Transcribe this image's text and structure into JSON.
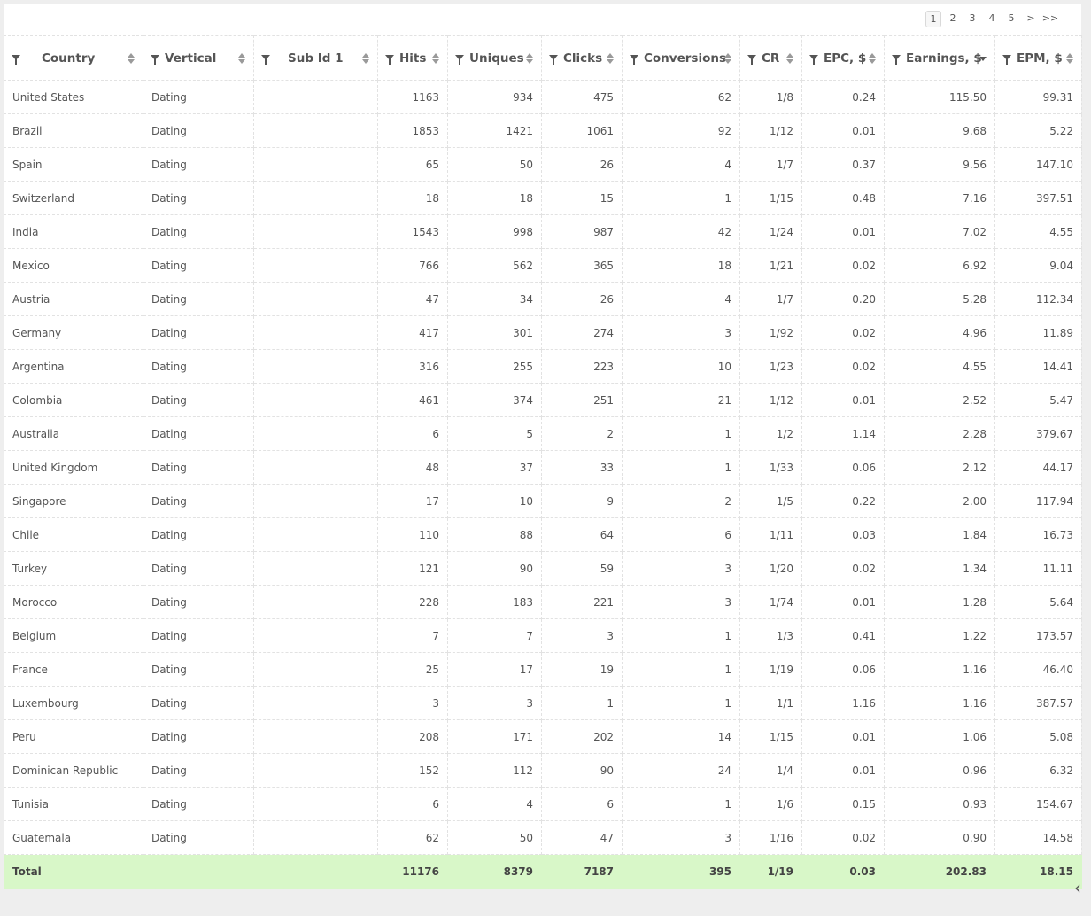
{
  "pagination": {
    "pages": [
      "1",
      "2",
      "3",
      "4",
      "5"
    ],
    "active": "1",
    "next_label": ">",
    "last_label": ">>"
  },
  "columns": [
    {
      "key": "country",
      "label": "Country"
    },
    {
      "key": "vertical",
      "label": "Vertical"
    },
    {
      "key": "subid",
      "label": "Sub Id 1"
    },
    {
      "key": "hits",
      "label": "Hits"
    },
    {
      "key": "uniques",
      "label": "Uniques"
    },
    {
      "key": "clicks",
      "label": "Clicks"
    },
    {
      "key": "conversions",
      "label": "Conversions"
    },
    {
      "key": "cr",
      "label": "CR"
    },
    {
      "key": "epc",
      "label": "EPC, $"
    },
    {
      "key": "earnings",
      "label": "Earnings, $"
    },
    {
      "key": "epm",
      "label": "EPM, $"
    }
  ],
  "sorted_column": "earnings",
  "sort_direction": "desc",
  "rows": [
    [
      "United States",
      "Dating",
      "",
      "1163",
      "934",
      "475",
      "62",
      "1/8",
      "0.24",
      "115.50",
      "99.31"
    ],
    [
      "Brazil",
      "Dating",
      "",
      "1853",
      "1421",
      "1061",
      "92",
      "1/12",
      "0.01",
      "9.68",
      "5.22"
    ],
    [
      "Spain",
      "Dating",
      "",
      "65",
      "50",
      "26",
      "4",
      "1/7",
      "0.37",
      "9.56",
      "147.10"
    ],
    [
      "Switzerland",
      "Dating",
      "",
      "18",
      "18",
      "15",
      "1",
      "1/15",
      "0.48",
      "7.16",
      "397.51"
    ],
    [
      "India",
      "Dating",
      "",
      "1543",
      "998",
      "987",
      "42",
      "1/24",
      "0.01",
      "7.02",
      "4.55"
    ],
    [
      "Mexico",
      "Dating",
      "",
      "766",
      "562",
      "365",
      "18",
      "1/21",
      "0.02",
      "6.92",
      "9.04"
    ],
    [
      "Austria",
      "Dating",
      "",
      "47",
      "34",
      "26",
      "4",
      "1/7",
      "0.20",
      "5.28",
      "112.34"
    ],
    [
      "Germany",
      "Dating",
      "",
      "417",
      "301",
      "274",
      "3",
      "1/92",
      "0.02",
      "4.96",
      "11.89"
    ],
    [
      "Argentina",
      "Dating",
      "",
      "316",
      "255",
      "223",
      "10",
      "1/23",
      "0.02",
      "4.55",
      "14.41"
    ],
    [
      "Colombia",
      "Dating",
      "",
      "461",
      "374",
      "251",
      "21",
      "1/12",
      "0.01",
      "2.52",
      "5.47"
    ],
    [
      "Australia",
      "Dating",
      "",
      "6",
      "5",
      "2",
      "1",
      "1/2",
      "1.14",
      "2.28",
      "379.67"
    ],
    [
      "United Kingdom",
      "Dating",
      "",
      "48",
      "37",
      "33",
      "1",
      "1/33",
      "0.06",
      "2.12",
      "44.17"
    ],
    [
      "Singapore",
      "Dating",
      "",
      "17",
      "10",
      "9",
      "2",
      "1/5",
      "0.22",
      "2.00",
      "117.94"
    ],
    [
      "Chile",
      "Dating",
      "",
      "110",
      "88",
      "64",
      "6",
      "1/11",
      "0.03",
      "1.84",
      "16.73"
    ],
    [
      "Turkey",
      "Dating",
      "",
      "121",
      "90",
      "59",
      "3",
      "1/20",
      "0.02",
      "1.34",
      "11.11"
    ],
    [
      "Morocco",
      "Dating",
      "",
      "228",
      "183",
      "221",
      "3",
      "1/74",
      "0.01",
      "1.28",
      "5.64"
    ],
    [
      "Belgium",
      "Dating",
      "",
      "7",
      "7",
      "3",
      "1",
      "1/3",
      "0.41",
      "1.22",
      "173.57"
    ],
    [
      "France",
      "Dating",
      "",
      "25",
      "17",
      "19",
      "1",
      "1/19",
      "0.06",
      "1.16",
      "46.40"
    ],
    [
      "Luxembourg",
      "Dating",
      "",
      "3",
      "3",
      "1",
      "1",
      "1/1",
      "1.16",
      "1.16",
      "387.57"
    ],
    [
      "Peru",
      "Dating",
      "",
      "208",
      "171",
      "202",
      "14",
      "1/15",
      "0.01",
      "1.06",
      "5.08"
    ],
    [
      "Dominican Republic",
      "Dating",
      "",
      "152",
      "112",
      "90",
      "24",
      "1/4",
      "0.01",
      "0.96",
      "6.32"
    ],
    [
      "Tunisia",
      "Dating",
      "",
      "6",
      "4",
      "6",
      "1",
      "1/6",
      "0.15",
      "0.93",
      "154.67"
    ],
    [
      "Guatemala",
      "Dating",
      "",
      "62",
      "50",
      "47",
      "3",
      "1/16",
      "0.02",
      "0.90",
      "14.58"
    ]
  ],
  "total": [
    "Total",
    "",
    "",
    "11176",
    "8379",
    "7187",
    "395",
    "1/19",
    "0.03",
    "202.83",
    "18.15"
  ],
  "icons": {
    "filter": "filter-icon",
    "sort": "sort-icon",
    "collapse": "chevron-left-icon"
  },
  "colors": {
    "total_row_bg": "#d8f7c8",
    "page_bg": "#eeeeee"
  }
}
